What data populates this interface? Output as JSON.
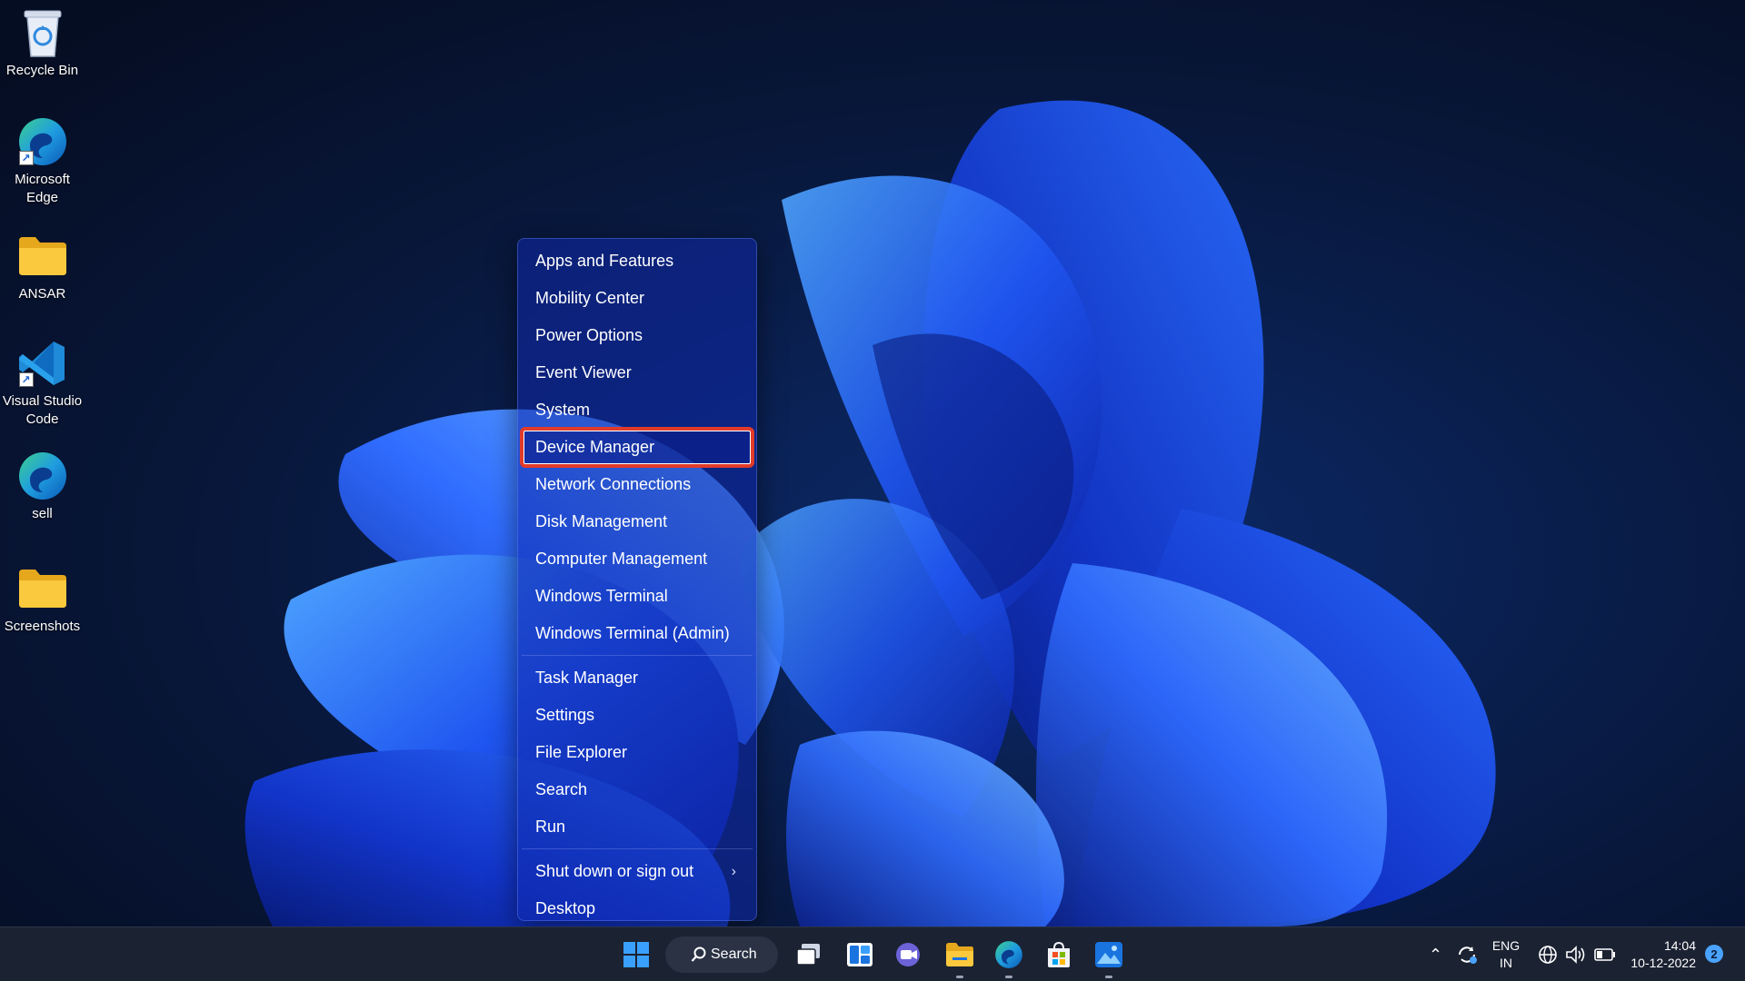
{
  "desktop": {
    "icons": [
      {
        "label": "Recycle Bin",
        "icon": "recycle-bin-icon"
      },
      {
        "label": "Microsoft Edge",
        "icon": "edge-icon"
      },
      {
        "label": "ANSAR",
        "icon": "folder-icon"
      },
      {
        "label": "Visual Studio Code",
        "icon": "vscode-icon"
      },
      {
        "label": "sell",
        "icon": "edge-icon"
      },
      {
        "label": "Screenshots",
        "icon": "folder-icon"
      }
    ]
  },
  "menu": {
    "groups": [
      [
        {
          "label": "Apps and Features"
        },
        {
          "label": "Mobility Center"
        },
        {
          "label": "Power Options"
        },
        {
          "label": "Event Viewer"
        },
        {
          "label": "System"
        },
        {
          "label": "Device Manager",
          "highlighted": true
        },
        {
          "label": "Network Connections"
        },
        {
          "label": "Disk Management"
        },
        {
          "label": "Computer Management"
        },
        {
          "label": "Windows Terminal"
        },
        {
          "label": "Windows Terminal (Admin)"
        }
      ],
      [
        {
          "label": "Task Manager"
        },
        {
          "label": "Settings"
        },
        {
          "label": "File Explorer"
        },
        {
          "label": "Search"
        },
        {
          "label": "Run"
        }
      ],
      [
        {
          "label": "Shut down or sign out",
          "submenu": true
        },
        {
          "label": "Desktop"
        }
      ]
    ],
    "highlight_color": "#e13b2b"
  },
  "taskbar": {
    "search_label": "Search",
    "apps": [
      "start-icon",
      "task-view-icon",
      "widgets-icon",
      "chat-icon",
      "file-explorer-icon",
      "edge-icon",
      "store-icon",
      "photos-icon"
    ],
    "tray": {
      "language_line1": "ENG",
      "language_line2": "IN",
      "time": "14:04",
      "date": "10-12-2022",
      "notification_count": "2"
    }
  },
  "colors": {
    "desktop_bg": "#07132b",
    "taskbar_bg": "#1b2232",
    "accent": "#1f6fff"
  }
}
